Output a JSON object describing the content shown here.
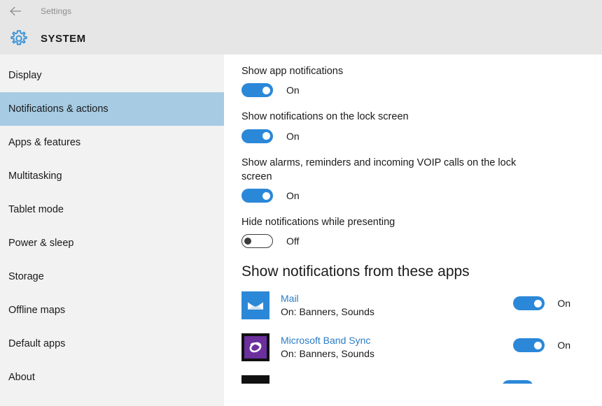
{
  "titlebar": {
    "back_icon": "back-arrow-icon",
    "title": "Settings"
  },
  "header": {
    "icon": "gear-icon",
    "title": "SYSTEM"
  },
  "sidebar": {
    "items": [
      {
        "label": "Display",
        "selected": false
      },
      {
        "label": "Notifications & actions",
        "selected": true
      },
      {
        "label": "Apps & features",
        "selected": false
      },
      {
        "label": "Multitasking",
        "selected": false
      },
      {
        "label": "Tablet mode",
        "selected": false
      },
      {
        "label": "Power & sleep",
        "selected": false
      },
      {
        "label": "Storage",
        "selected": false
      },
      {
        "label": "Offline maps",
        "selected": false
      },
      {
        "label": "Default apps",
        "selected": false
      },
      {
        "label": "About",
        "selected": false
      }
    ]
  },
  "settings": [
    {
      "label": "Show app notifications",
      "state": "On",
      "on": true
    },
    {
      "label": "Show notifications on the lock screen",
      "state": "On",
      "on": true
    },
    {
      "label": "Show alarms, reminders and incoming VOIP calls on the lock screen",
      "state": "On",
      "on": true
    },
    {
      "label": "Hide notifications while presenting",
      "state": "Off",
      "on": false
    }
  ],
  "apps_section": {
    "heading": "Show notifications from these apps",
    "apps": [
      {
        "name": "Mail",
        "status": "On: Banners, Sounds",
        "state": "On",
        "on": true,
        "icon": "mail-envelope-icon",
        "tile_color": "#2b88d8"
      },
      {
        "name": "Microsoft Band Sync",
        "status": "On: Banners, Sounds",
        "state": "On",
        "on": true,
        "icon": "band-sync-icon",
        "tile_color": "#6b2f9e"
      }
    ]
  },
  "colors": {
    "accent": "#2b88d8",
    "selected_nav": "#a6cbe3",
    "sidebar_bg": "#f2f2f2",
    "header_bg": "#e6e6e6",
    "link": "#2b7cc4"
  }
}
